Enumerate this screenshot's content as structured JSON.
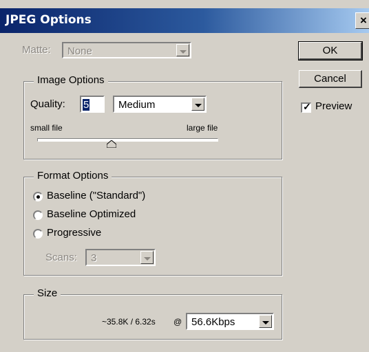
{
  "window": {
    "title": "JPEG Options",
    "close_glyph": "×"
  },
  "matte": {
    "label": "Matte:",
    "value": "None"
  },
  "image_options": {
    "legend": "Image Options",
    "quality_label": "Quality:",
    "quality_value": "5",
    "quality_preset": "Medium",
    "small_file_label": "small file",
    "large_file_label": "large file",
    "slider_value_fraction": 0.42
  },
  "format_options": {
    "legend": "Format Options",
    "radios": [
      {
        "label": "Baseline (\"Standard\")",
        "selected": true
      },
      {
        "label": "Baseline Optimized",
        "selected": false
      },
      {
        "label": "Progressive",
        "selected": false
      }
    ],
    "scans_label": "Scans:",
    "scans_value": "3"
  },
  "size": {
    "legend": "Size",
    "estimate": "~35.8K / 6.32s",
    "at": "@",
    "connection": "56.6Kbps"
  },
  "buttons": {
    "ok": "OK",
    "cancel": "Cancel"
  },
  "preview": {
    "label": "Preview",
    "checked": true
  },
  "icons": [
    "close-icon",
    "dropdown-arrow-icon",
    "slider-thumb-icon",
    "checkmark-icon"
  ],
  "colors": {
    "face": "#d4d0c8",
    "title_start": "#0a246a",
    "title_end": "#a6caf0"
  }
}
